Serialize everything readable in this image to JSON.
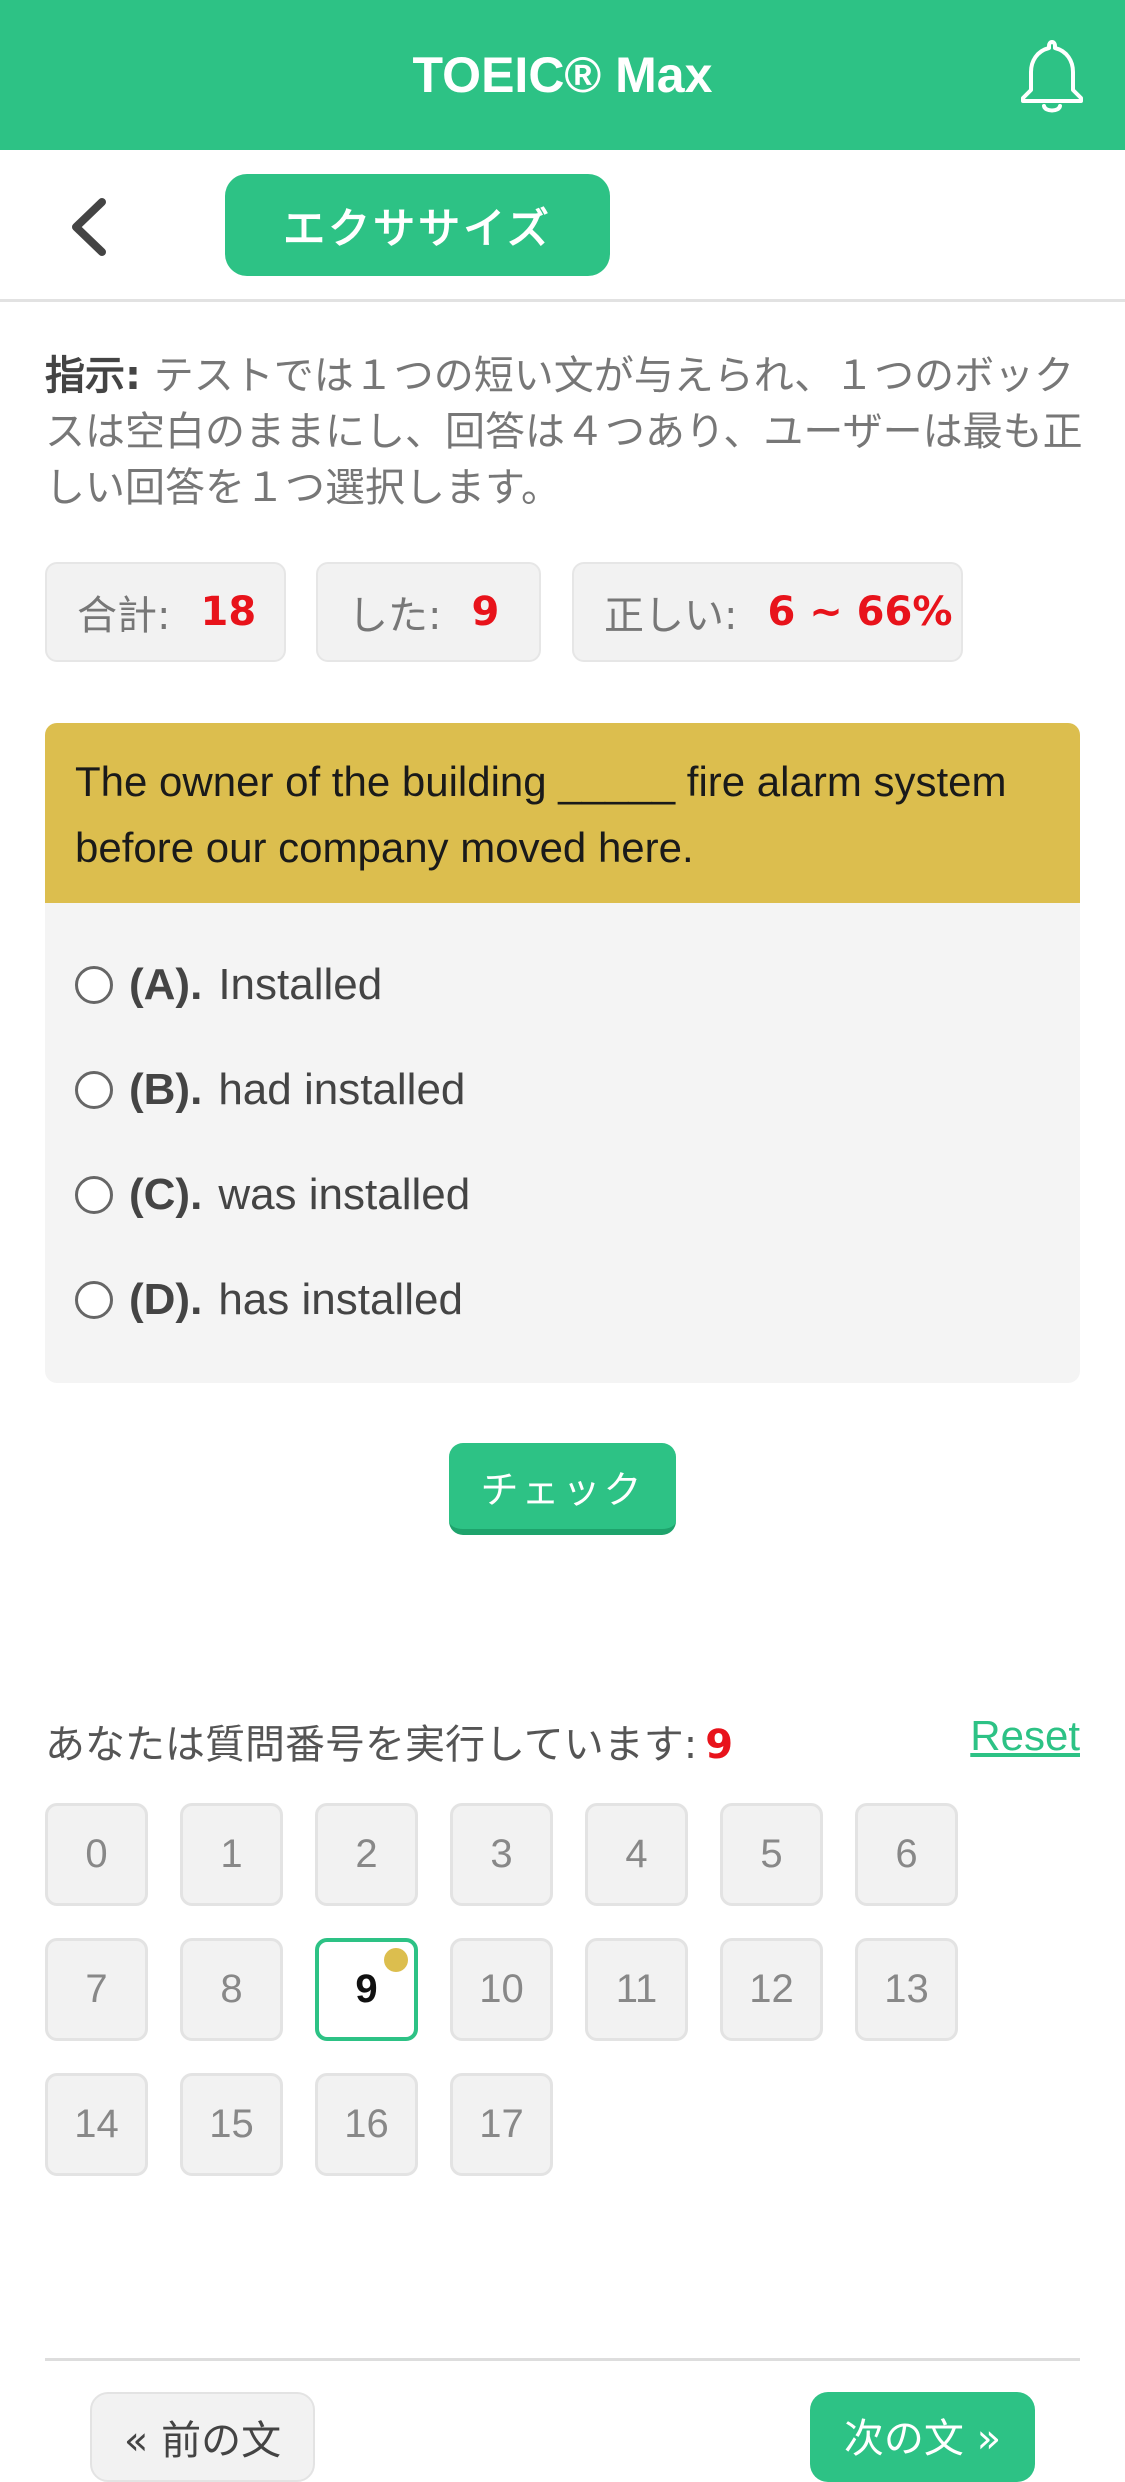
{
  "header": {
    "title": "TOEIC® Max",
    "bell_icon": "bell-icon"
  },
  "subnav": {
    "back_icon": "chevron-left-icon",
    "tab_label": "エクササイズ"
  },
  "instructions": {
    "label": "指示:",
    "text": " テストでは１つの短い文が与えられ、１つのボックスは空白のままにし、回答は４つあり、ユーザーは最も正しい回答を１つ選択します。"
  },
  "stats": {
    "total_label": "合計:",
    "total_value": "18",
    "done_label": "した:",
    "done_value": "9",
    "correct_label": "正しい:",
    "correct_value": "6 ~ 66%"
  },
  "question": {
    "text": "The owner of the building _____ fire alarm system before our company moved here.",
    "options": [
      {
        "letter": "(A).",
        "text": "Installed"
      },
      {
        "letter": "(B).",
        "text": "had installed"
      },
      {
        "letter": "(C).",
        "text": "was installed"
      },
      {
        "letter": "(D).",
        "text": "has installed"
      }
    ]
  },
  "check_button": "チェック",
  "progress": {
    "label": "あなたは質問番号を実行しています:",
    "current": "9",
    "reset": "Reset",
    "numbers": [
      "0",
      "1",
      "2",
      "3",
      "4",
      "5",
      "6",
      "7",
      "8",
      "9",
      "10",
      "11",
      "12",
      "13",
      "14",
      "15",
      "16",
      "17"
    ]
  },
  "footer": {
    "prev": "« 前の文",
    "next": "次の文 »"
  },
  "colors": {
    "primary": "#2dc285",
    "question_bg": "#dcbe4e",
    "accent_red": "#e8131b"
  }
}
